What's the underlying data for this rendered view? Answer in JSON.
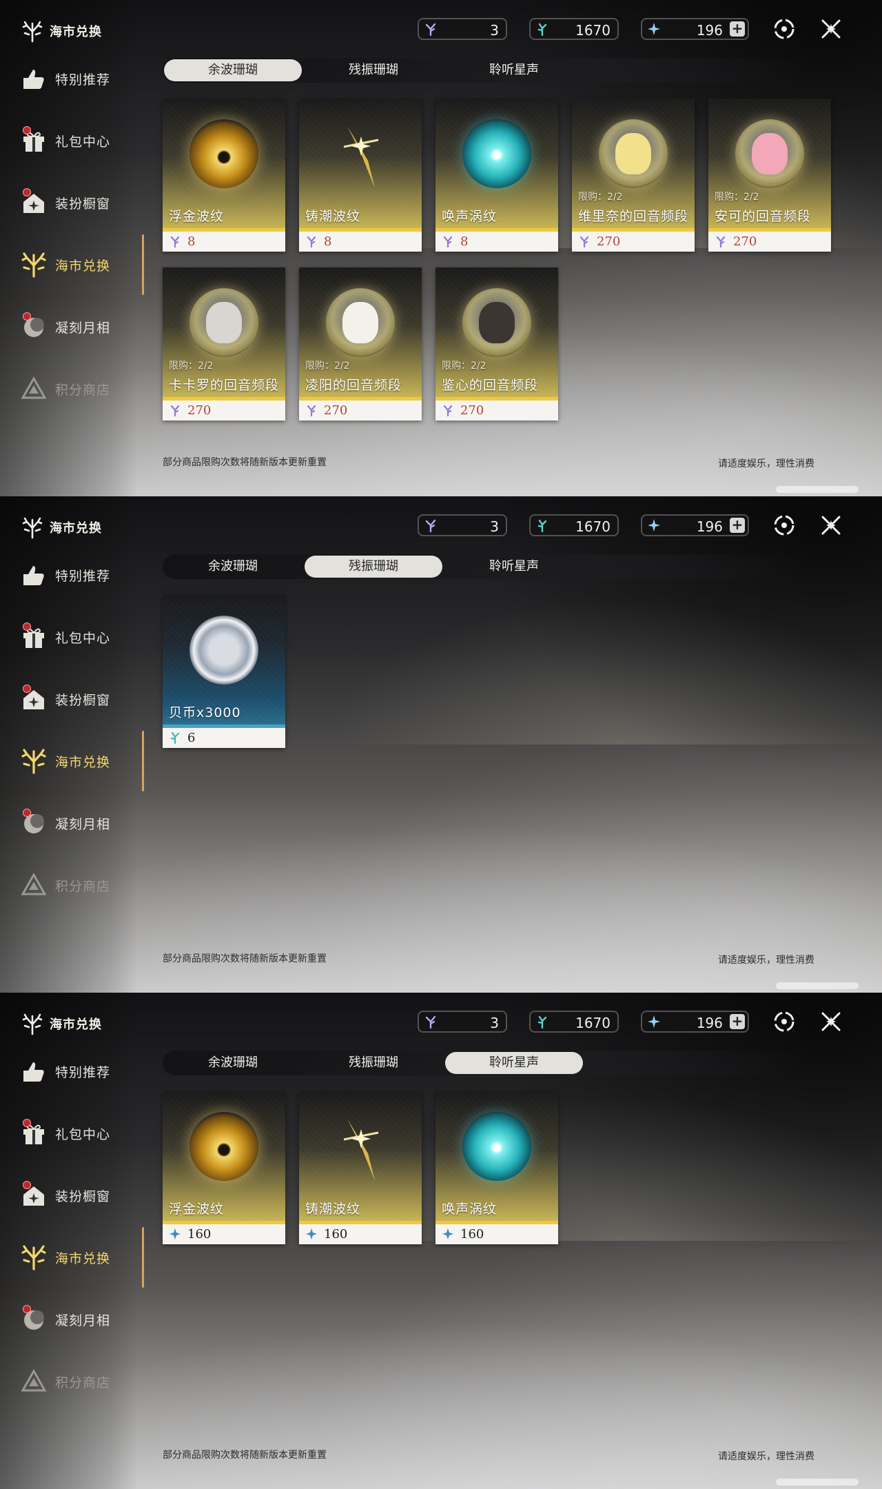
{
  "header": {
    "title": "海市兑换"
  },
  "currencies": [
    {
      "name": "coral-currency",
      "value": "3"
    },
    {
      "name": "wave-currency",
      "value": "1670"
    },
    {
      "name": "star-currency",
      "value": "196"
    }
  ],
  "sidebar": {
    "items": [
      {
        "label": "特别推荐",
        "badge": false
      },
      {
        "label": "礼包中心",
        "badge": true
      },
      {
        "label": "装扮橱窗",
        "badge": true
      },
      {
        "label": "海市兑换",
        "badge": false,
        "active": true
      },
      {
        "label": "凝刻月相",
        "badge": true
      },
      {
        "label": "积分商店",
        "badge": false,
        "dim": true
      }
    ]
  },
  "tabs": [
    "余波珊瑚",
    "残振珊瑚",
    "聆听星声"
  ],
  "footer": {
    "note": "部分商品限购次数将随新版本更新重置",
    "right": "请适度娱乐，理性消费"
  },
  "panels": [
    {
      "active_tab": 0,
      "items": [
        {
          "name": "浮金波纹",
          "price": "8",
          "limit": ""
        },
        {
          "name": "铸潮波纹",
          "price": "8",
          "limit": ""
        },
        {
          "name": "唤声涡纹",
          "price": "8",
          "limit": ""
        },
        {
          "name": "维里奈的回音频段",
          "price": "270",
          "limit": "限购：2/2"
        },
        {
          "name": "安可的回音频段",
          "price": "270",
          "limit": "限购：2/2"
        },
        {
          "name": "卡卡罗的回音频段",
          "price": "270",
          "limit": "限购：2/2"
        },
        {
          "name": "凌阳的回音频段",
          "price": "270",
          "limit": "限购：2/2"
        },
        {
          "name": "鉴心的回音频段",
          "price": "270",
          "limit": "限购：2/2"
        }
      ]
    },
    {
      "active_tab": 1,
      "items": [
        {
          "name": "贝币x3000",
          "price": "6",
          "limit": ""
        }
      ]
    },
    {
      "active_tab": 2,
      "items": [
        {
          "name": "浮金波纹",
          "price": "160",
          "limit": ""
        },
        {
          "name": "铸潮波纹",
          "price": "160",
          "limit": ""
        },
        {
          "name": "唤声涡纹",
          "price": "160",
          "limit": ""
        }
      ]
    }
  ],
  "colors": {
    "accent_gold": "#f3d86b",
    "price_red": "#b5433a",
    "card_stripe_gold": "#f0c93c",
    "card_stripe_blue": "#4aa2c8"
  }
}
